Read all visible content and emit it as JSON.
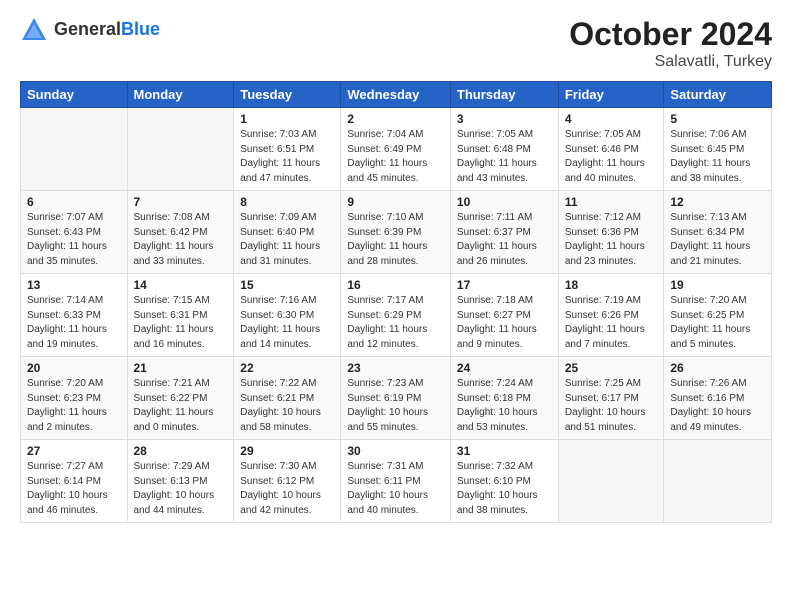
{
  "logo": {
    "general": "General",
    "blue": "Blue"
  },
  "title": "October 2024",
  "subtitle": "Salavatli, Turkey",
  "weekdays": [
    "Sunday",
    "Monday",
    "Tuesday",
    "Wednesday",
    "Thursday",
    "Friday",
    "Saturday"
  ],
  "weeks": [
    [
      {
        "day": "",
        "info": ""
      },
      {
        "day": "",
        "info": ""
      },
      {
        "day": "1",
        "info": "Sunrise: 7:03 AM\nSunset: 6:51 PM\nDaylight: 11 hours and 47 minutes."
      },
      {
        "day": "2",
        "info": "Sunrise: 7:04 AM\nSunset: 6:49 PM\nDaylight: 11 hours and 45 minutes."
      },
      {
        "day": "3",
        "info": "Sunrise: 7:05 AM\nSunset: 6:48 PM\nDaylight: 11 hours and 43 minutes."
      },
      {
        "day": "4",
        "info": "Sunrise: 7:05 AM\nSunset: 6:46 PM\nDaylight: 11 hours and 40 minutes."
      },
      {
        "day": "5",
        "info": "Sunrise: 7:06 AM\nSunset: 6:45 PM\nDaylight: 11 hours and 38 minutes."
      }
    ],
    [
      {
        "day": "6",
        "info": "Sunrise: 7:07 AM\nSunset: 6:43 PM\nDaylight: 11 hours and 35 minutes."
      },
      {
        "day": "7",
        "info": "Sunrise: 7:08 AM\nSunset: 6:42 PM\nDaylight: 11 hours and 33 minutes."
      },
      {
        "day": "8",
        "info": "Sunrise: 7:09 AM\nSunset: 6:40 PM\nDaylight: 11 hours and 31 minutes."
      },
      {
        "day": "9",
        "info": "Sunrise: 7:10 AM\nSunset: 6:39 PM\nDaylight: 11 hours and 28 minutes."
      },
      {
        "day": "10",
        "info": "Sunrise: 7:11 AM\nSunset: 6:37 PM\nDaylight: 11 hours and 26 minutes."
      },
      {
        "day": "11",
        "info": "Sunrise: 7:12 AM\nSunset: 6:36 PM\nDaylight: 11 hours and 23 minutes."
      },
      {
        "day": "12",
        "info": "Sunrise: 7:13 AM\nSunset: 6:34 PM\nDaylight: 11 hours and 21 minutes."
      }
    ],
    [
      {
        "day": "13",
        "info": "Sunrise: 7:14 AM\nSunset: 6:33 PM\nDaylight: 11 hours and 19 minutes."
      },
      {
        "day": "14",
        "info": "Sunrise: 7:15 AM\nSunset: 6:31 PM\nDaylight: 11 hours and 16 minutes."
      },
      {
        "day": "15",
        "info": "Sunrise: 7:16 AM\nSunset: 6:30 PM\nDaylight: 11 hours and 14 minutes."
      },
      {
        "day": "16",
        "info": "Sunrise: 7:17 AM\nSunset: 6:29 PM\nDaylight: 11 hours and 12 minutes."
      },
      {
        "day": "17",
        "info": "Sunrise: 7:18 AM\nSunset: 6:27 PM\nDaylight: 11 hours and 9 minutes."
      },
      {
        "day": "18",
        "info": "Sunrise: 7:19 AM\nSunset: 6:26 PM\nDaylight: 11 hours and 7 minutes."
      },
      {
        "day": "19",
        "info": "Sunrise: 7:20 AM\nSunset: 6:25 PM\nDaylight: 11 hours and 5 minutes."
      }
    ],
    [
      {
        "day": "20",
        "info": "Sunrise: 7:20 AM\nSunset: 6:23 PM\nDaylight: 11 hours and 2 minutes."
      },
      {
        "day": "21",
        "info": "Sunrise: 7:21 AM\nSunset: 6:22 PM\nDaylight: 11 hours and 0 minutes."
      },
      {
        "day": "22",
        "info": "Sunrise: 7:22 AM\nSunset: 6:21 PM\nDaylight: 10 hours and 58 minutes."
      },
      {
        "day": "23",
        "info": "Sunrise: 7:23 AM\nSunset: 6:19 PM\nDaylight: 10 hours and 55 minutes."
      },
      {
        "day": "24",
        "info": "Sunrise: 7:24 AM\nSunset: 6:18 PM\nDaylight: 10 hours and 53 minutes."
      },
      {
        "day": "25",
        "info": "Sunrise: 7:25 AM\nSunset: 6:17 PM\nDaylight: 10 hours and 51 minutes."
      },
      {
        "day": "26",
        "info": "Sunrise: 7:26 AM\nSunset: 6:16 PM\nDaylight: 10 hours and 49 minutes."
      }
    ],
    [
      {
        "day": "27",
        "info": "Sunrise: 7:27 AM\nSunset: 6:14 PM\nDaylight: 10 hours and 46 minutes."
      },
      {
        "day": "28",
        "info": "Sunrise: 7:29 AM\nSunset: 6:13 PM\nDaylight: 10 hours and 44 minutes."
      },
      {
        "day": "29",
        "info": "Sunrise: 7:30 AM\nSunset: 6:12 PM\nDaylight: 10 hours and 42 minutes."
      },
      {
        "day": "30",
        "info": "Sunrise: 7:31 AM\nSunset: 6:11 PM\nDaylight: 10 hours and 40 minutes."
      },
      {
        "day": "31",
        "info": "Sunrise: 7:32 AM\nSunset: 6:10 PM\nDaylight: 10 hours and 38 minutes."
      },
      {
        "day": "",
        "info": ""
      },
      {
        "day": "",
        "info": ""
      }
    ]
  ]
}
